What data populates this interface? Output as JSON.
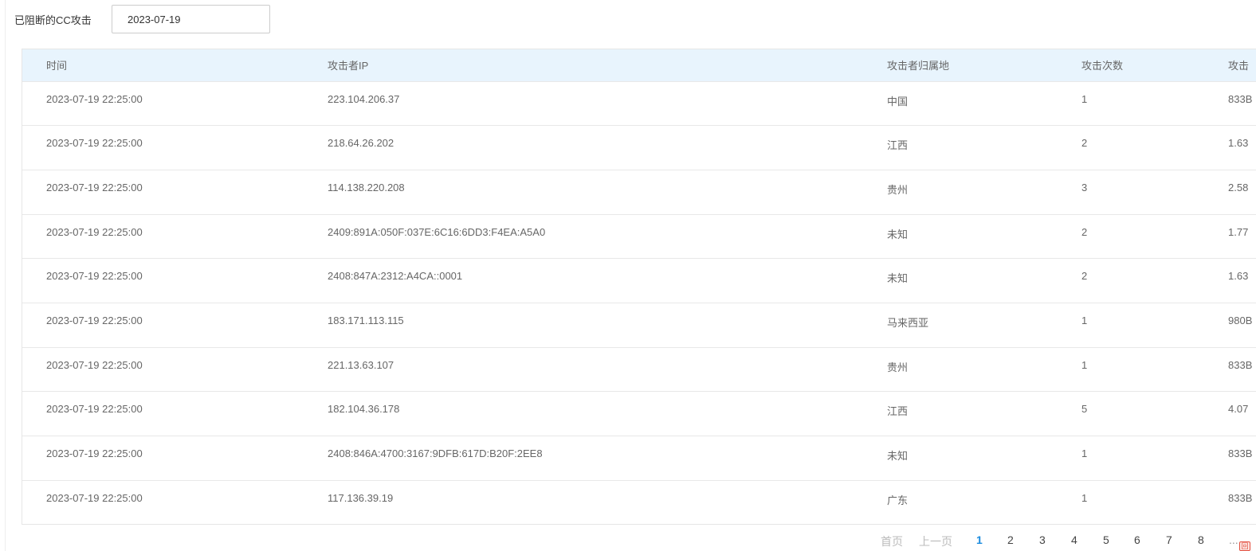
{
  "filter": {
    "label": "已阻断的CC攻击",
    "date_value": "2023-07-19"
  },
  "table": {
    "columns": [
      "时间",
      "攻击者IP",
      "攻击者归属地",
      "攻击次数",
      "攻击"
    ],
    "rows": [
      [
        "2023-07-19 22:25:00",
        "223.104.206.37",
        "中国",
        "1",
        "833B"
      ],
      [
        "2023-07-19 22:25:00",
        "218.64.26.202",
        "江西",
        "2",
        "1.63"
      ],
      [
        "2023-07-19 22:25:00",
        "114.138.220.208",
        "贵州",
        "3",
        "2.58"
      ],
      [
        "2023-07-19 22:25:00",
        "2409:891A:050F:037E:6C16:6DD3:F4EA:A5A0",
        "未知",
        "2",
        "1.77"
      ],
      [
        "2023-07-19 22:25:00",
        "2408:847A:2312:A4CA::0001",
        "未知",
        "2",
        "1.63"
      ],
      [
        "2023-07-19 22:25:00",
        "183.171.113.115",
        "马来西亚",
        "1",
        "980B"
      ],
      [
        "2023-07-19 22:25:00",
        "221.13.63.107",
        "贵州",
        "1",
        "833B"
      ],
      [
        "2023-07-19 22:25:00",
        "182.104.36.178",
        "江西",
        "5",
        "4.07"
      ],
      [
        "2023-07-19 22:25:00",
        "2408:846A:4700:3167:9DFB:617D:B20F:2EE8",
        "未知",
        "1",
        "833B"
      ],
      [
        "2023-07-19 22:25:00",
        "117.136.39.19",
        "广东",
        "1",
        "833B"
      ]
    ]
  },
  "pagination": {
    "first_label": "首页",
    "prev_label": "上一页",
    "pages": [
      "1",
      "2",
      "3",
      "4",
      "5",
      "6",
      "7",
      "8"
    ],
    "current_page": "1",
    "more_label": "...",
    "corner_badge": "回"
  },
  "colors": {
    "header_bg": "#e8f4fd",
    "active_page": "#1a8bde",
    "text": "#666666"
  }
}
